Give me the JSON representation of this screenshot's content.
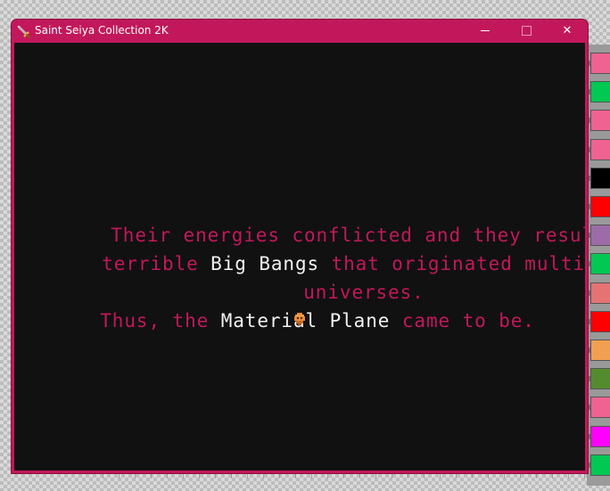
{
  "window": {
    "title": "Saint Seiya Collection 2K",
    "frame_color": "#c2185b",
    "controls": {
      "minimize_icon": "minimize-icon",
      "maximize_icon": "maximize-icon",
      "close_icon": "close-icon",
      "close_glyph": "✕"
    }
  },
  "game": {
    "background": "#111111",
    "text_color": "#c2185b",
    "highlight_color": "#f2f2f2",
    "lines": [
      [
        "Their energies conflicted and they resulted in"
      ],
      [
        "terrible ",
        "Big Bangs",
        " that originated multiple"
      ],
      [
        "universes."
      ],
      [
        "Thus, the ",
        "Material Plane",
        " came to be."
      ]
    ],
    "continue_indicator": "advance-cursor-icon"
  },
  "desktop": {
    "palette_colors": [
      "#f06292",
      "#00c853",
      "#f06292",
      "#f06292",
      "#000000",
      "#ff0000",
      "#9c6ba8",
      "#00c853",
      "#e57373",
      "#ff0000",
      "#f0a050",
      "#558b2f",
      "#f06292",
      "#ff00ff",
      "#00c853"
    ]
  }
}
